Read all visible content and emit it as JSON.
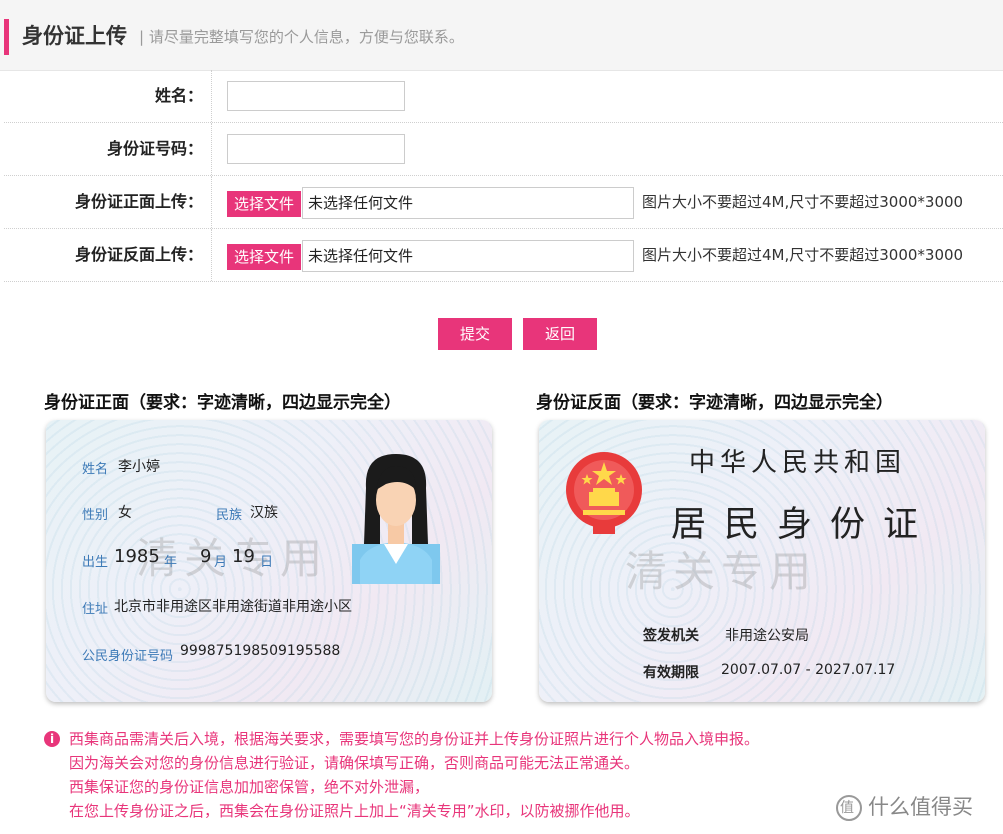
{
  "header": {
    "title": "身份证上传",
    "subtitle": "| 请尽量完整填写您的个人信息，方便与您联系。"
  },
  "form": {
    "name_label": "姓名：",
    "id_number_label": "身份证号码：",
    "front_upload_label": "身份证正面上传：",
    "back_upload_label": "身份证反面上传：",
    "choose_file_label": "选择文件",
    "no_file_text": "未选择任何文件",
    "file_hint": "图片大小不要超过4M,尺寸不要超过3000*3000",
    "name_value": "",
    "id_number_value": ""
  },
  "actions": {
    "submit_label": "提交",
    "back_label": "返回"
  },
  "samples": {
    "front_title": "身份证正面（要求：字迹清晰，四边显示完全）",
    "back_title": "身份证反面（要求：字迹清晰，四边显示完全）",
    "watermark": "清关专用",
    "front": {
      "name_label": "姓名",
      "name_value": "李小婷",
      "sex_label": "性别",
      "sex_value": "女",
      "ethnic_label": "民族",
      "ethnic_value": "汉族",
      "birth_label": "出生",
      "birth_year": "1985",
      "year_char": "年",
      "birth_month": "9",
      "month_char": "月",
      "birth_day": "19",
      "day_char": "日",
      "address_label": "住址",
      "address_value": "北京市非用途区非用途街道非用途小区",
      "id_label": "公民身份证号码",
      "id_value": "999875198509195588"
    },
    "back": {
      "title1": "中华人民共和国",
      "title2": "居民身份证",
      "authority_label": "签发机关",
      "authority_value": "非用途公安局",
      "validity_label": "有效期限",
      "validity_value": "2007.07.07 - 2027.07.17"
    }
  },
  "notice": {
    "icon": "info-icon",
    "lines": [
      "西集商品需清关后入境，根据海关要求，需要填写您的身份证并上传身份证照片进行个人物品入境申报。",
      "因为海关会对您的身份信息进行验证，请确保填写正确，否则商品可能无法正常通关。",
      "西集保证您的身份证信息加加密保管，绝不对外泄漏，",
      "在您上传身份证之后，西集会在身份证照片上加上“清关专用”水印，以防被挪作他用。"
    ]
  },
  "brand": {
    "text": "什么值得买"
  },
  "colors": {
    "accent": "#e8357a",
    "label_blue": "#3d7ab7"
  }
}
